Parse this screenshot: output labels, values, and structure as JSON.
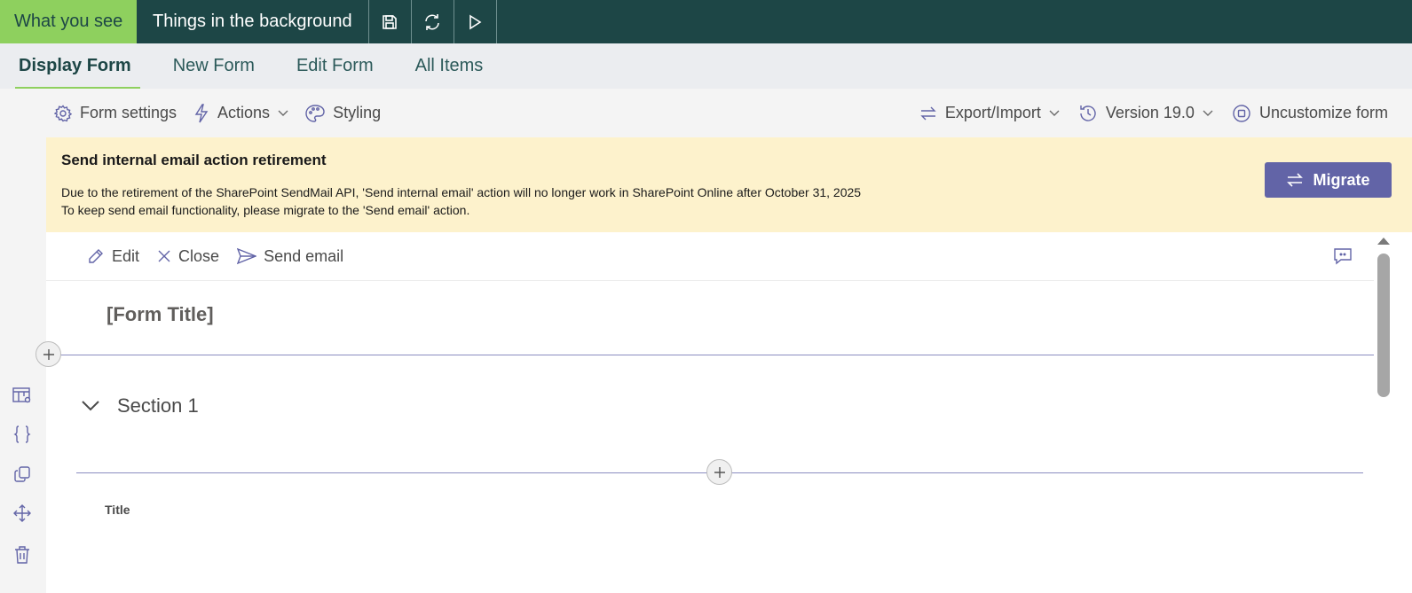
{
  "topbar": {
    "tab_what_you_see": "What you see",
    "tab_background": "Things in the background",
    "icons": [
      "save-icon",
      "refresh-icon",
      "play-icon"
    ],
    "colors": {
      "bg": "#1d4646",
      "accent": "#8ed05e"
    }
  },
  "form_tabs": [
    {
      "label": "Display Form",
      "active": true
    },
    {
      "label": "New Form",
      "active": false
    },
    {
      "label": "Edit Form",
      "active": false
    },
    {
      "label": "All Items",
      "active": false
    }
  ],
  "toolbar": {
    "form_settings": "Form settings",
    "actions": "Actions",
    "styling": "Styling",
    "export_import": "Export/Import",
    "version": "Version 19.0",
    "uncustomize": "Uncustomize form"
  },
  "banner": {
    "title": "Send internal email action retirement",
    "line1": "Due to the retirement of the SharePoint SendMail API, 'Send internal email' action will no longer work in SharePoint Online after October 31, 2025",
    "line2": "To keep send email functionality, please migrate to the 'Send email' action.",
    "button": "Migrate",
    "colors": {
      "bg": "#fdf2cc",
      "button": "#6264a7"
    }
  },
  "form": {
    "actions": {
      "edit": "Edit",
      "close": "Close",
      "send_email": "Send email"
    },
    "title": "[Form Title]",
    "section_title": "Section 1",
    "field_label": "Title"
  },
  "rail_icons": [
    "table-settings-icon",
    "code-braces-icon",
    "copy-icon",
    "move-icon",
    "delete-icon"
  ]
}
